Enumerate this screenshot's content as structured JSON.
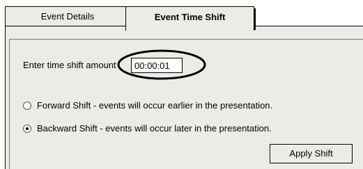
{
  "tabs": {
    "event_details": "Event Details",
    "event_time_shift": "Event Time Shift"
  },
  "form": {
    "shift_label": "Enter time shift amount",
    "shift_value": "00:00:01",
    "forward_label": "Forward Shift - events will occur earlier in the presentation.",
    "backward_label": "Backward Shift - events will occur later in the presentation.",
    "selected": "backward",
    "apply_label": "Apply Shift"
  },
  "colors": {
    "panel_bg": "#ecebe6",
    "border": "#000000"
  }
}
